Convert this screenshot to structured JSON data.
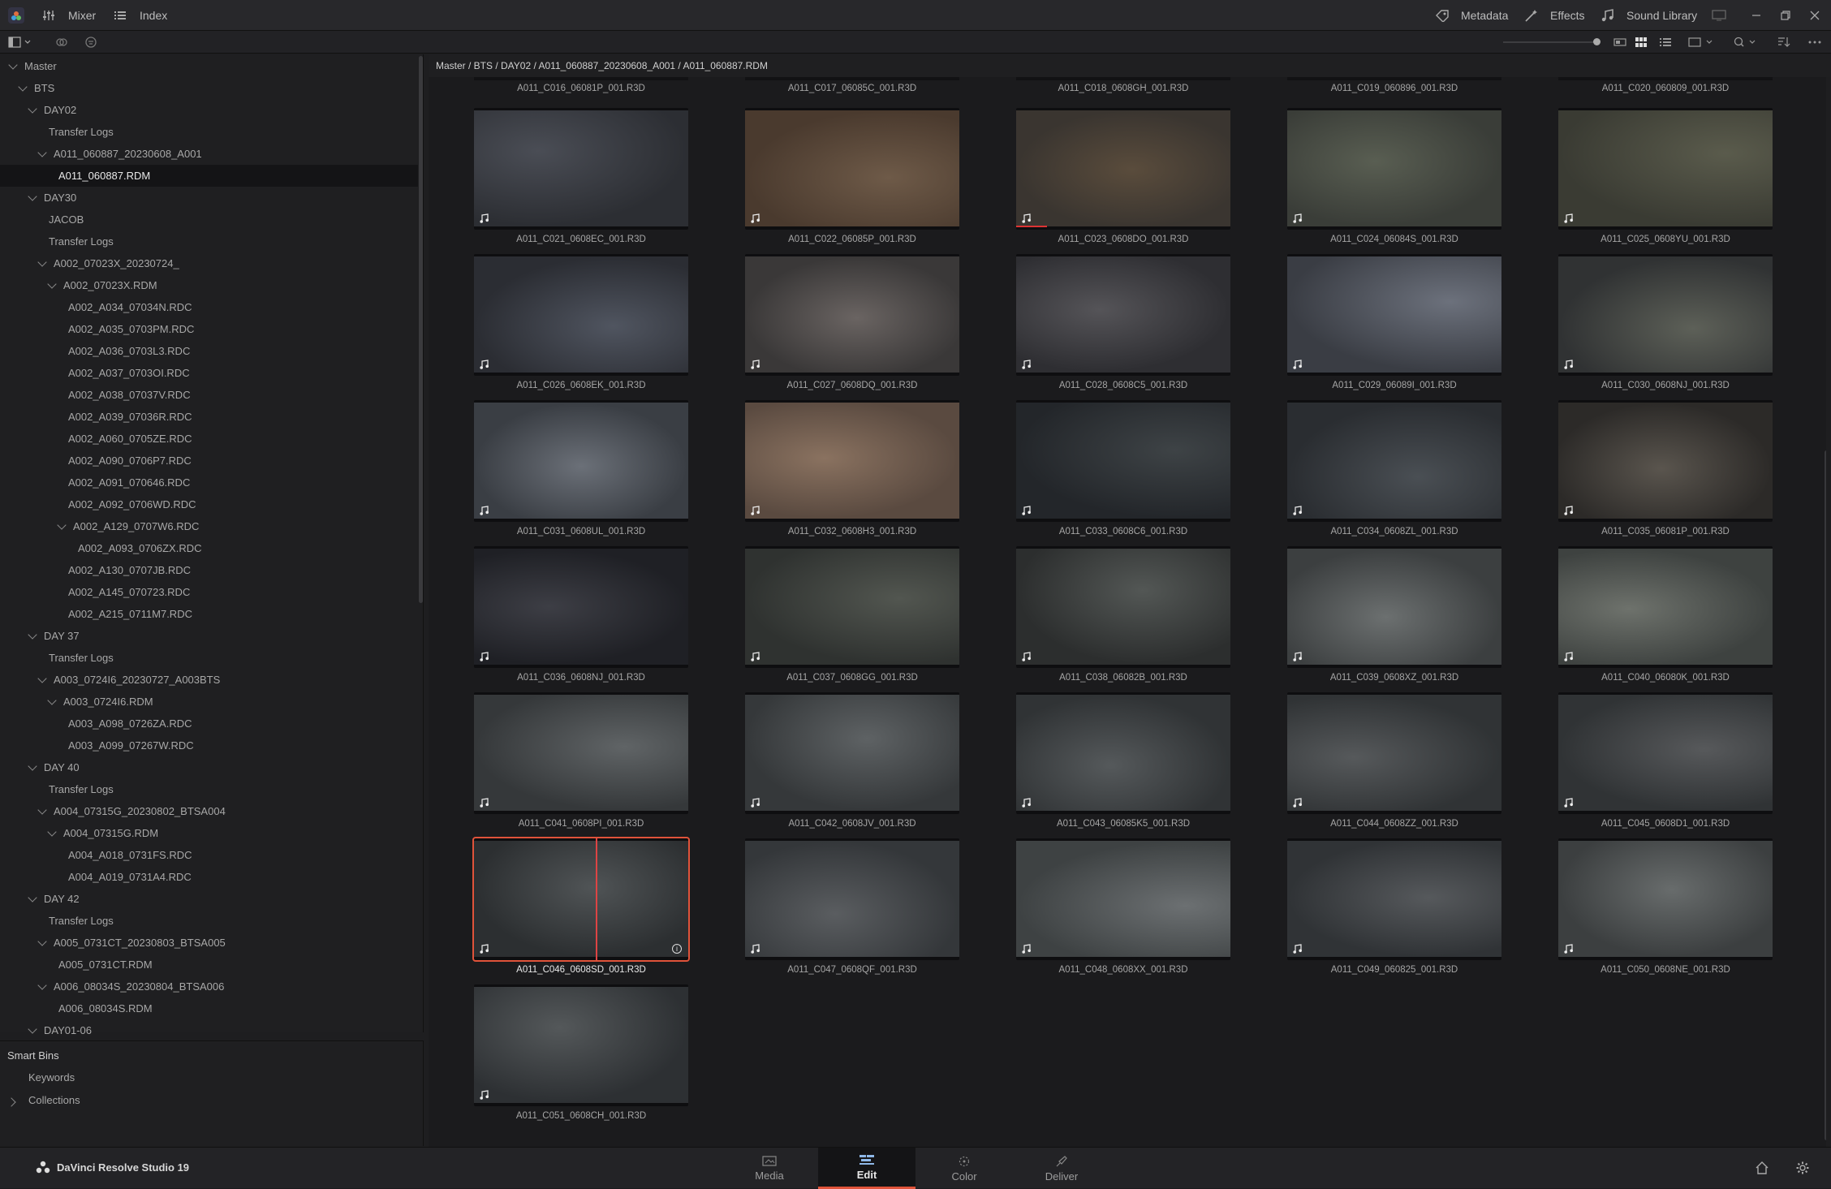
{
  "titlebar": {
    "mixer": "Mixer",
    "index": "Index",
    "metadata": "Metadata",
    "effects": "Effects",
    "sound_library": "Sound Library"
  },
  "path": "Master / BTS / DAY02 / A011_060887_20230608_A001 / A011_060887.RDM",
  "tree": [
    {
      "label": "Master",
      "indent": 0,
      "chev": "down"
    },
    {
      "label": "BTS",
      "indent": 1,
      "chev": "down"
    },
    {
      "label": "DAY02",
      "indent": 2,
      "chev": "down"
    },
    {
      "label": "Transfer Logs",
      "indent": 3,
      "chev": ""
    },
    {
      "label": "A011_060887_20230608_A001",
      "indent": 3,
      "chev": "down"
    },
    {
      "label": "A011_060887.RDM",
      "indent": 4,
      "chev": "",
      "sel": true
    },
    {
      "label": "DAY30",
      "indent": 2,
      "chev": "down"
    },
    {
      "label": "JACOB",
      "indent": 3,
      "chev": ""
    },
    {
      "label": "Transfer Logs",
      "indent": 3,
      "chev": ""
    },
    {
      "label": "A002_07023X_20230724_",
      "indent": 3,
      "chev": "down"
    },
    {
      "label": "A002_07023X.RDM",
      "indent": 4,
      "chev": "down"
    },
    {
      "label": "A002_A034_07034N.RDC",
      "indent": 5,
      "chev": ""
    },
    {
      "label": "A002_A035_0703PM.RDC",
      "indent": 5,
      "chev": ""
    },
    {
      "label": "A002_A036_0703L3.RDC",
      "indent": 5,
      "chev": ""
    },
    {
      "label": "A002_A037_0703OI.RDC",
      "indent": 5,
      "chev": ""
    },
    {
      "label": "A002_A038_07037V.RDC",
      "indent": 5,
      "chev": ""
    },
    {
      "label": "A002_A039_07036R.RDC",
      "indent": 5,
      "chev": ""
    },
    {
      "label": "A002_A060_0705ZE.RDC",
      "indent": 5,
      "chev": ""
    },
    {
      "label": "A002_A090_0706P7.RDC",
      "indent": 5,
      "chev": ""
    },
    {
      "label": "A002_A091_070646.RDC",
      "indent": 5,
      "chev": ""
    },
    {
      "label": "A002_A092_0706WD.RDC",
      "indent": 5,
      "chev": ""
    },
    {
      "label": "A002_A129_0707W6.RDC",
      "indent": 5,
      "chev": "down"
    },
    {
      "label": "A002_A093_0706ZX.RDC",
      "indent": 6,
      "chev": ""
    },
    {
      "label": "A002_A130_0707JB.RDC",
      "indent": 5,
      "chev": ""
    },
    {
      "label": "A002_A145_070723.RDC",
      "indent": 5,
      "chev": ""
    },
    {
      "label": "A002_A215_0711M7.RDC",
      "indent": 5,
      "chev": ""
    },
    {
      "label": "DAY 37",
      "indent": 2,
      "chev": "down"
    },
    {
      "label": "Transfer Logs",
      "indent": 3,
      "chev": ""
    },
    {
      "label": "A003_0724I6_20230727_A003BTS",
      "indent": 3,
      "chev": "down"
    },
    {
      "label": "A003_0724I6.RDM",
      "indent": 4,
      "chev": "down"
    },
    {
      "label": "A003_A098_0726ZA.RDC",
      "indent": 5,
      "chev": ""
    },
    {
      "label": "A003_A099_07267W.RDC",
      "indent": 5,
      "chev": ""
    },
    {
      "label": "DAY 40",
      "indent": 2,
      "chev": "down"
    },
    {
      "label": "Transfer Logs",
      "indent": 3,
      "chev": ""
    },
    {
      "label": "A004_07315G_20230802_BTSA004",
      "indent": 3,
      "chev": "down"
    },
    {
      "label": "A004_07315G.RDM",
      "indent": 4,
      "chev": "down"
    },
    {
      "label": "A004_A018_0731FS.RDC",
      "indent": 5,
      "chev": ""
    },
    {
      "label": "A004_A019_0731A4.RDC",
      "indent": 5,
      "chev": ""
    },
    {
      "label": "DAY 42",
      "indent": 2,
      "chev": "down"
    },
    {
      "label": "Transfer Logs",
      "indent": 3,
      "chev": ""
    },
    {
      "label": "A005_0731CT_20230803_BTSA005",
      "indent": 3,
      "chev": "down"
    },
    {
      "label": "A005_0731CT.RDM",
      "indent": 4,
      "chev": ""
    },
    {
      "label": "A006_08034S_20230804_BTSA006",
      "indent": 3,
      "chev": "down"
    },
    {
      "label": "A006_08034S.RDM",
      "indent": 4,
      "chev": ""
    },
    {
      "label": "DAY01-06",
      "indent": 2,
      "chev": "down"
    }
  ],
  "smart_bins": {
    "title": "Smart Bins",
    "keywords": "Keywords",
    "collections": "Collections"
  },
  "top_labels": [
    "A011_C016_06081P_001.R3D",
    "A011_C017_06085C_001.R3D",
    "A011_C018_0608GH_001.R3D",
    "A011_C019_060896_001.R3D",
    "A011_C020_060809_001.R3D"
  ],
  "clips": [
    "A011_C021_0608EC_001.R3D",
    "A011_C022_06085P_001.R3D",
    "A011_C023_0608DO_001.R3D",
    "A011_C024_06084S_001.R3D",
    "A011_C025_0608YU_001.R3D",
    "A011_C026_0608EK_001.R3D",
    "A011_C027_0608DQ_001.R3D",
    "A011_C028_0608C5_001.R3D",
    "A011_C029_06089I_001.R3D",
    "A011_C030_0608NJ_001.R3D",
    "A011_C031_0608UL_001.R3D",
    "A011_C032_0608H3_001.R3D",
    "A011_C033_0608C6_001.R3D",
    "A011_C034_0608ZL_001.R3D",
    "A011_C035_06081P_001.R3D",
    "A011_C036_0608NJ_001.R3D",
    "A011_C037_0608GG_001.R3D",
    "A011_C038_06082B_001.R3D",
    "A011_C039_0608XZ_001.R3D",
    "A011_C040_06080K_001.R3D",
    "A011_C041_0608PI_001.R3D",
    "A011_C042_0608JV_001.R3D",
    "A011_C043_06085K5_001.R3D",
    "A011_C044_0608ZZ_001.R3D",
    "A011_C045_0608D1_001.R3D",
    "A011_C046_0608SD_001.R3D",
    "A011_C047_0608QF_001.R3D",
    "A011_C048_0608XX_001.R3D",
    "A011_C049_060825_001.R3D",
    "A011_C050_0608NE_001.R3D",
    "A011_C051_0608CH_001.R3D"
  ],
  "clip_colors": [
    [
      "#2c2e33",
      "#4a4d55"
    ],
    [
      "#4a3a2e",
      "#6e5a48"
    ],
    [
      "#3a3530",
      "#5a4c3c"
    ],
    [
      "#3a3d38",
      "#595e52"
    ],
    [
      "#3a3b33",
      "#5a5b4c"
    ],
    [
      "#2b2d33",
      "#505560"
    ],
    [
      "#3a3838",
      "#6a6462"
    ],
    [
      "#2e2e32",
      "#555458"
    ],
    [
      "#3a3d44",
      "#6c717c"
    ],
    [
      "#303233",
      "#5d6058"
    ],
    [
      "#3a3e44",
      "#6b7078"
    ],
    [
      "#5a4a40",
      "#8a7260"
    ],
    [
      "#23262a",
      "#3e4346"
    ],
    [
      "#2a2d31",
      "#4a4f54"
    ],
    [
      "#2c2a28",
      "#5a554e"
    ],
    [
      "#1f2025",
      "#3d3e45"
    ],
    [
      "#2f3230",
      "#525650"
    ],
    [
      "#2c2e2e",
      "#535755"
    ],
    [
      "#3c3f40",
      "#6c7070"
    ],
    [
      "#3e4240",
      "#6e726c"
    ],
    [
      "#35383a",
      "#606466"
    ],
    [
      "#35383a",
      "#5e6264"
    ],
    [
      "#303335",
      "#55595b"
    ],
    [
      "#303335",
      "#56595b"
    ],
    [
      "#303335",
      "#57595b"
    ],
    [
      "#2c2f31",
      "#505456"
    ],
    [
      "#34373a",
      "#5a5d60"
    ],
    [
      "#3e4243",
      "#6c7072"
    ],
    [
      "#303336",
      "#56595c"
    ],
    [
      "#3c3f40",
      "#686c6c"
    ],
    [
      "#2d3033",
      "#54585a"
    ]
  ],
  "bottom": {
    "app": "DaVinci Resolve Studio 19",
    "pages": [
      "Media",
      "Edit",
      "Color",
      "Deliver"
    ],
    "active": "Edit"
  }
}
